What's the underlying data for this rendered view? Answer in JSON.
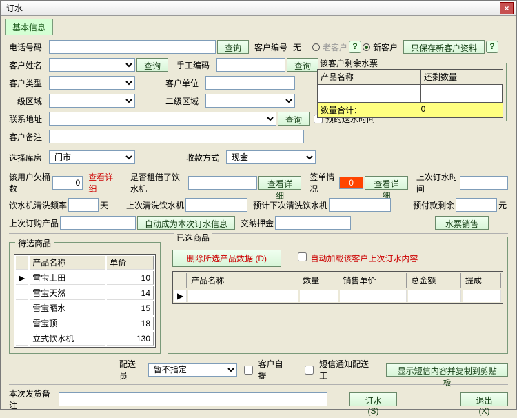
{
  "window": {
    "title": "订水"
  },
  "tabs": {
    "basic": "基本信息"
  },
  "labels": {
    "phone": "电话号码",
    "custNo": "客户编号",
    "custNoVal": "无",
    "oldCust": "老客户",
    "newCust": "新客户",
    "saveNew": "只保存新客户资料",
    "custName": "客户姓名",
    "manualCode": "手工编码",
    "ticketLegend": "该客户剩余水票",
    "custType": "客户类型",
    "custUnit": "客户单位",
    "area1": "一级区域",
    "area2": "二级区域",
    "contact": "联系地址",
    "apptTime": "预约送水时间",
    "remark": "客户备注",
    "warehouse": "选择库房",
    "payMethod": "收款方式",
    "owe": "该用户欠桶数",
    "viewDetail": "查看详细",
    "rentCooler": "是否租借了饮水机",
    "signStatus": "签单情况",
    "lastOrder": "上次订水时间",
    "cleanFreq": "饮水机清洗频率",
    "days": "天",
    "lastClean": "上次清洗饮水机",
    "nextClean": "预计下次清洗饮水机",
    "prepayBal": "预付款剩余",
    "yuan": "元",
    "lastProducts": "上次订购产品",
    "autoFill": "自动成为本次订水信息",
    "deposit": "交纳押金",
    "ticketSale": "水票销售",
    "waitProducts": "待选商品",
    "selProducts": "已选商品",
    "delSel": "删除所选产品数据",
    "delKey": "(D)",
    "autoLoad": "自动加载该客户上次订水内容",
    "colProd": "产品名称",
    "colRemain": "还剩数量",
    "sumQty": "数量合计：",
    "sumVal": "0",
    "colPrice": "单价",
    "colQty": "数量",
    "colSalePrice": "销售单价",
    "colTotal": "总金额",
    "colCommission": "提成",
    "deliverer": "配送员",
    "selfPickup": "客户自提",
    "smsNotify": "短信通知配送工",
    "showSms": "显示短信内容并复制到剪贴板",
    "orderRemark": "本次发货备注",
    "orderBtn": "订水(S)",
    "exitBtn": "退出(X)",
    "query": "查询",
    "signVal": "0"
  },
  "values": {
    "warehouse": "门市",
    "payMethod": "现金",
    "owe": "0",
    "deliverer": "暂不指定"
  },
  "waitProducts": [
    {
      "name": "雪宝上田",
      "price": "10"
    },
    {
      "name": "雪宝天然",
      "price": "14"
    },
    {
      "name": "雪宝晒水",
      "price": "15"
    },
    {
      "name": "雪宝顶",
      "price": "18"
    },
    {
      "name": "立式饮水机",
      "price": "130"
    }
  ]
}
